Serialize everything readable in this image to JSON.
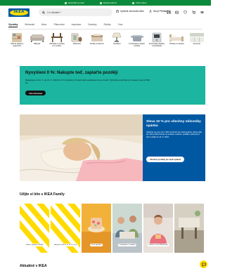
{
  "colors": {
    "top_bar": "#0a8a3a",
    "brand_blue": "#0058a3",
    "brand_yellow": "#ffdb00",
    "promo_green": "#1bb5a0",
    "stripe_yellow": "#ffdb00",
    "text": "#111111"
  },
  "top_bar": {
    "promos": [
      "Nová IKEA na cestě",
      "Doprava zdarma",
      "Online nákup"
    ]
  },
  "header": {
    "logo": "IKEA",
    "search_placeholder": "Co hledáte?",
    "store_link": "Vyberte obchodní dům",
    "account_link": "Ahoj! Přihlásit se",
    "icons": [
      "truck-icon",
      "delivery-icon",
      "heart-icon",
      "cart-icon",
      "menu-icon"
    ]
  },
  "nav": {
    "tabs": [
      "Výrobky",
      "Místnosti",
      "Akce",
      "Plánování",
      "Inspirace",
      "Novinky",
      "Služby",
      "Více"
    ],
    "active_index": 0
  },
  "categories": [
    {
      "label": "Úložné sklady a organizéry",
      "icon": "shelf-icon"
    },
    {
      "label": "Nábytek",
      "icon": "sofa-icon"
    },
    {
      "label": "Zahrada a výrobky pro venkov",
      "icon": "garden-icon"
    },
    {
      "label": "Dekorace",
      "icon": "decor-icon"
    },
    {
      "label": "Textilie a koberce",
      "icon": "textile-icon"
    },
    {
      "label": "Osvětlení",
      "icon": "lamp-icon"
    },
    {
      "label": "Kuchyňské a jídelní výrobky",
      "icon": "cookware-icon"
    },
    {
      "label": "Kuchyňské doplňky a spotřebiče",
      "icon": "appliance-icon"
    },
    {
      "label": "Postele a matrace",
      "icon": "bed-icon"
    },
    {
      "label": "Kuchyně",
      "icon": "kitchen-icon"
    }
  ],
  "promo_green": {
    "title": "Nyvyšlení 0 %: Nakupte teď, zaplaťte později",
    "text": "Nakupujte od 12. 4. do 31. 5. 2024 za 0 % navýšení. Financování poskytuje Home Credit. Výhodné podmínky pro nákupy nad 10 000 Kč.",
    "button": "Více informací"
  },
  "hero": {
    "title": "Sleva 10 % pro všechny milovníky spánku",
    "text": "Ušetřete na více než 1 500 výrobcích pro lepší spánek. Sleva platí pro členy IKEA Family na postele, matrace, polštáře, přikrývky a ložní prádlo do 30. 6. 2024.",
    "button": "Všechny výrobky pro lepší spánek"
  },
  "family": {
    "heading": "Užijte si léto s IKEA Family",
    "cards": [
      {
        "label": "Objevte výhodné nabídky",
        "style": "stripes"
      },
      {
        "label": "Nakupte na Slevu za 10 % a více",
        "style": "stripes"
      },
      {
        "label": "Letní výprodej",
        "style": "photo-food"
      },
      {
        "label": "Prohlédněte si nabídku",
        "style": "photo-people"
      },
      {
        "label": "Přihlaste se do IKEA Family",
        "style": "photo-person"
      },
      {
        "label": "",
        "style": "photo-outdoor"
      }
    ]
  },
  "news": {
    "heading": "Aktuálně v IKEA"
  }
}
